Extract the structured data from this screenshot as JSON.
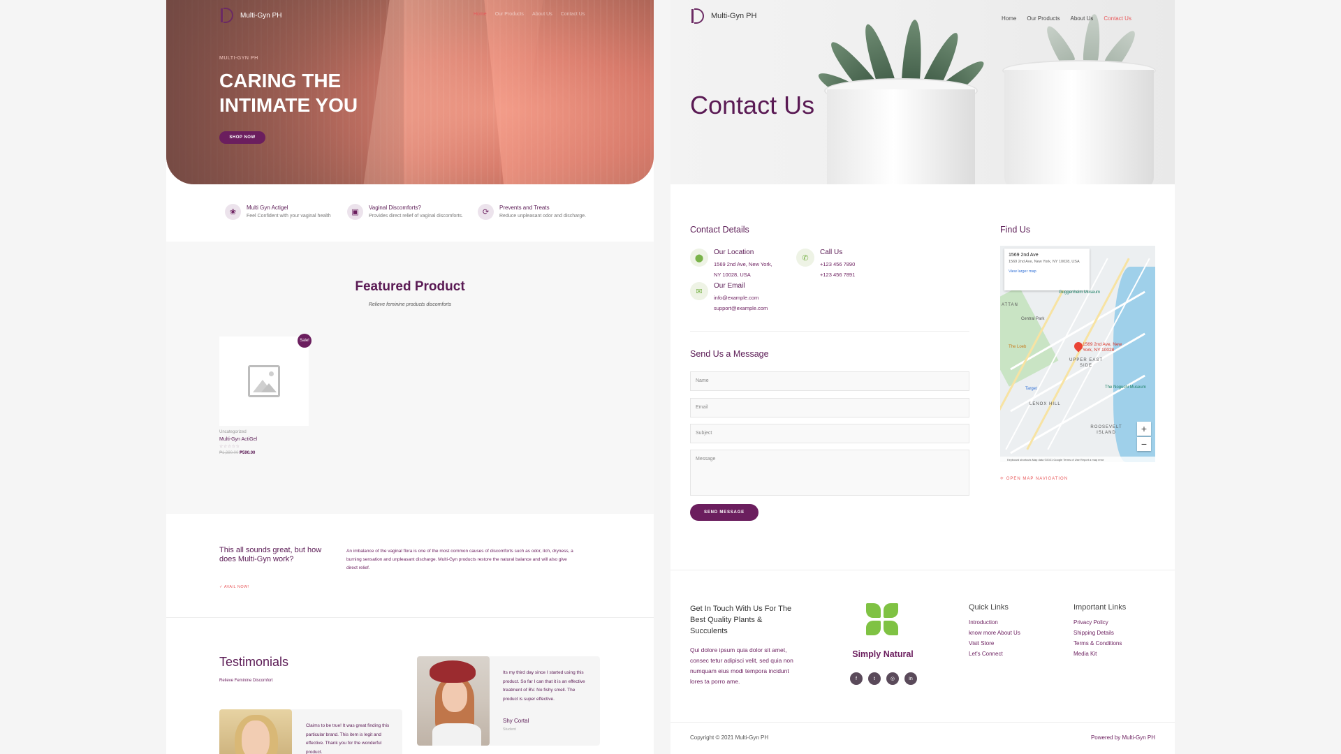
{
  "left": {
    "brand": "Multi-Gyn PH",
    "nav": [
      "Home",
      "Our Products",
      "About Us",
      "Contact Us"
    ],
    "hero": {
      "kicker": "MULTI-GYN PH",
      "title": "CARING THE INTIMATE YOU",
      "button": "SHOP NOW"
    },
    "features": [
      {
        "icon": "lotus-icon",
        "title": "Multi Gyn Actigel",
        "sub": "Feel Confident with your vaginal health"
      },
      {
        "icon": "box-icon",
        "title": "Vaginal Discomforts?",
        "sub": "Provides direct relief of vaginal discomforts."
      },
      {
        "icon": "refresh-icon",
        "title": "Prevents and Treats",
        "sub": "Reduce unpleasant odor and discharge."
      }
    ],
    "featured": {
      "title": "Featured Product",
      "subtitle": "Relieve feminine products discomforts"
    },
    "product": {
      "badge": "Sale!",
      "category": "Uncategorized",
      "name": "Multi-Gyn ActiGel",
      "stars": "☆☆☆☆☆",
      "old_price": "₱1,380.00",
      "price": "₱590.00"
    },
    "how": {
      "title": "This all sounds great, but how does Multi-Gyn work?",
      "text": "An imbalance of the vaginal flora is one of the most common causes of discomforts such as odor, itch, dryness, a burning sensation and unpleasant discharge. Multi-Gyn products restore the natural balance and will also give direct relief.",
      "link": "✓ AVAIL NOW!"
    },
    "testimonials": {
      "title": "Testimonials",
      "subtitle": "Relieve Feminine Discomfort",
      "items": [
        {
          "text": "Its my third day since I started using this product. So far I can that it is an effective treatment of BV. No fishy smell. The product is super effective.",
          "name": "Shy Cortal",
          "role": "Student"
        },
        {
          "text": "Claims to be true! It was great finding this particular brand. This item is legit and effective. Thank you for the wonderful product."
        }
      ]
    }
  },
  "right": {
    "brand": "Multi-Gyn PH",
    "nav": [
      "Home",
      "Our Products",
      "About Us",
      "Contact Us"
    ],
    "active_nav": "Contact Us",
    "page_title": "Contact Us",
    "contact_details": {
      "heading": "Contact Details",
      "location": {
        "title": "Our Location",
        "lines": [
          "1569 2nd Ave, New York,",
          "NY 10028, USA"
        ]
      },
      "call": {
        "title": "Call Us",
        "lines": [
          "+123 456 7890",
          "+123 456 7891"
        ]
      },
      "email": {
        "title": "Our Email",
        "lines": [
          "info@example.com",
          "support@example.com"
        ]
      }
    },
    "form": {
      "heading": "Send Us a Message",
      "name_placeholder": "Name",
      "email_placeholder": "Email",
      "subject_placeholder": "Subject",
      "message_placeholder": "Message",
      "button": "SEND MESSAGE"
    },
    "find_us": {
      "heading": "Find Us",
      "card_title": "1569 2nd Ave",
      "card_address": "1569 2nd Ave, New York, NY 10028, USA",
      "card_link": "View larger map",
      "pin_label": "1569 2nd Ave, New York, NY 10028",
      "labels": [
        "ATTAN",
        "Central Park",
        "UPPER EAST SIDE",
        "LENOX HILL",
        "ROOSEVELT ISLAND",
        "Guggenheim Museum",
        "The Loeb",
        "Target",
        "The Noguchi Museum"
      ],
      "footer": "Keyboard shortcuts   Map data ©2021 Google   Terms of Use   Report a map error",
      "open_nav": "✈ OPEN MAP NAVIGATION"
    },
    "footer": {
      "heading": "Get In Touch With Us For The Best Quality Plants & Succulents",
      "text": "Qui dolore ipsum quia dolor sit amet, consec tetur adipisci velit, sed quia non numquam eius modi tempora incidunt lores ta porro ame.",
      "brand": "Simply Natural",
      "socials": [
        "f",
        "t",
        "◎",
        "in"
      ],
      "quick_links": {
        "heading": "Quick Links",
        "items": [
          "Introduction",
          "know more About Us",
          "Visit Store",
          "Let's Connect"
        ]
      },
      "important_links": {
        "heading": "Important Links",
        "items": [
          "Privacy Policy",
          "Shipping Details",
          "Terms & Conditions",
          "Media Kit"
        ]
      },
      "copyright": "Copyright © 2021 Multi-Gyn PH",
      "powered": "Powered by Multi-Gyn PH"
    }
  },
  "colors": {
    "brand_purple": "#6b1e5e",
    "accent_red": "#e8585a",
    "green": "#7fc243"
  }
}
